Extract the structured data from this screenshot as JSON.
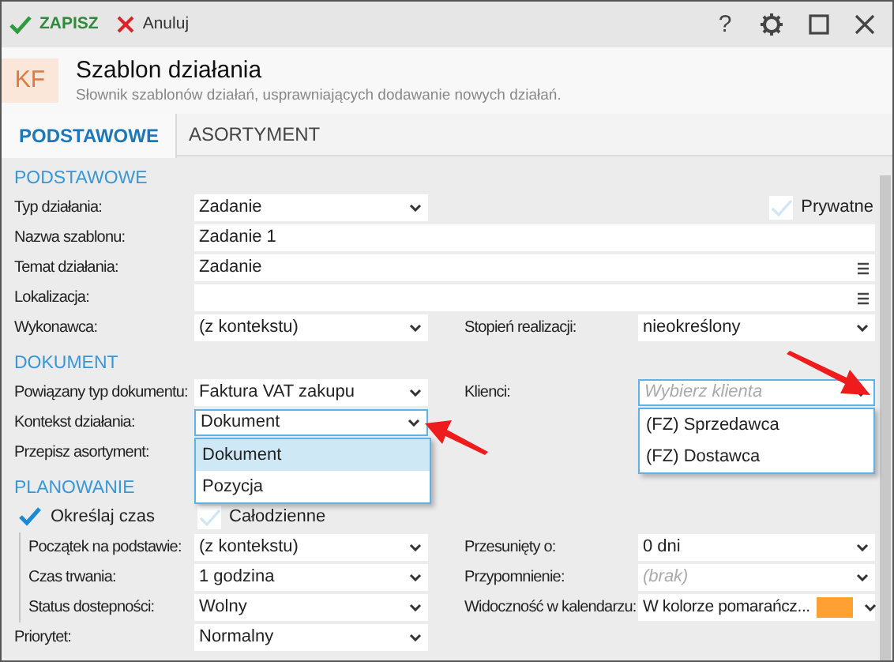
{
  "toolbar": {
    "buttons": [
      {
        "kind": "save",
        "label": "ZAPISZ"
      },
      {
        "kind": "cancel",
        "label": "Anuluj"
      }
    ],
    "help": "?"
  },
  "header": {
    "badge": "KF",
    "title": "Szablon działania",
    "subtitle": "Słownik szablonów działań, usprawniających dodawanie nowych działań."
  },
  "tabs": [
    {
      "label": "PODSTAWOWE",
      "selected": true
    },
    {
      "label": "ASORTYMENT",
      "selected": false
    }
  ],
  "sections": [
    {
      "title": "PODSTAWOWE",
      "rows": [
        {
          "label": "Typ działania:",
          "field": {
            "kind": "select",
            "value": "Zadanie"
          },
          "right": {
            "kind": "checkbox",
            "label": "Prywatne",
            "checked": false
          }
        },
        {
          "label": "Nazwa szablonu:",
          "field": {
            "kind": "text",
            "value": "Zadanie 1"
          }
        },
        {
          "label": "Temat działania:",
          "field": {
            "kind": "menu",
            "value": "Zadanie"
          }
        },
        {
          "label": "Lokalizacja:",
          "field": {
            "kind": "menu"
          }
        },
        {
          "label": "Wykonawca:",
          "field": {
            "kind": "select",
            "value": "(z kontekstu)"
          },
          "right": {
            "kind": "field",
            "label": "Stopień realizacji:",
            "field": {
              "kind": "select",
              "value": "nieokreślony"
            }
          }
        }
      ]
    },
    {
      "title": "DOKUMENT",
      "rows": [
        {
          "label": "Powiązany typ dokumentu:",
          "field": {
            "kind": "select",
            "value": "Faktura VAT zakupu"
          },
          "right": {
            "kind": "field",
            "label": "Klienci:",
            "field": {
              "kind": "select",
              "placeholder": "Wybierz klienta",
              "focused": true,
              "options": [
                {
                  "label": "(FZ) Sprzedawca",
                  "selected": false
                },
                {
                  "label": "(FZ) Dostawca",
                  "selected": false
                }
              ]
            }
          }
        },
        {
          "label": "Kontekst działania:",
          "field": {
            "kind": "select",
            "value": "Dokument",
            "focused": true,
            "options": [
              {
                "label": "Dokument",
                "selected": true
              },
              {
                "label": "Pozycja",
                "selected": false
              }
            ]
          }
        },
        {
          "label": "Przepisz asortyment:"
        }
      ]
    },
    {
      "title": "PLANOWANIE",
      "rows": [
        {
          "kind": "checks",
          "checks": [
            {
              "label": "Określaj czas",
              "checked": true
            },
            {
              "label": "Całodzienne",
              "checked": false
            }
          ]
        },
        {
          "label": "Początek na podstawie:",
          "indented": true,
          "field": {
            "kind": "select",
            "value": "(z kontekstu)"
          },
          "right": {
            "kind": "field",
            "label": "Przesunięty o:",
            "field": {
              "kind": "select",
              "value": "0 dni"
            }
          }
        },
        {
          "label": "Czas trwania:",
          "indented": true,
          "field": {
            "kind": "select",
            "value": "1 godzina"
          },
          "right": {
            "kind": "field",
            "label": "Przypomnienie:",
            "field": {
              "kind": "select",
              "placeholder": "(brak)"
            }
          }
        },
        {
          "label": "Status dostepności:",
          "indented": true,
          "field": {
            "kind": "select",
            "value": "Wolny"
          },
          "right": {
            "kind": "field",
            "label": "Widoczność w kalendarzu:",
            "field": {
              "kind": "select",
              "value": "W kolorze pomarańcz...",
              "color": "#ffa033"
            }
          }
        },
        {
          "label": "Priorytet:",
          "field": {
            "kind": "select",
            "value": "Normalny"
          }
        }
      ]
    }
  ]
}
